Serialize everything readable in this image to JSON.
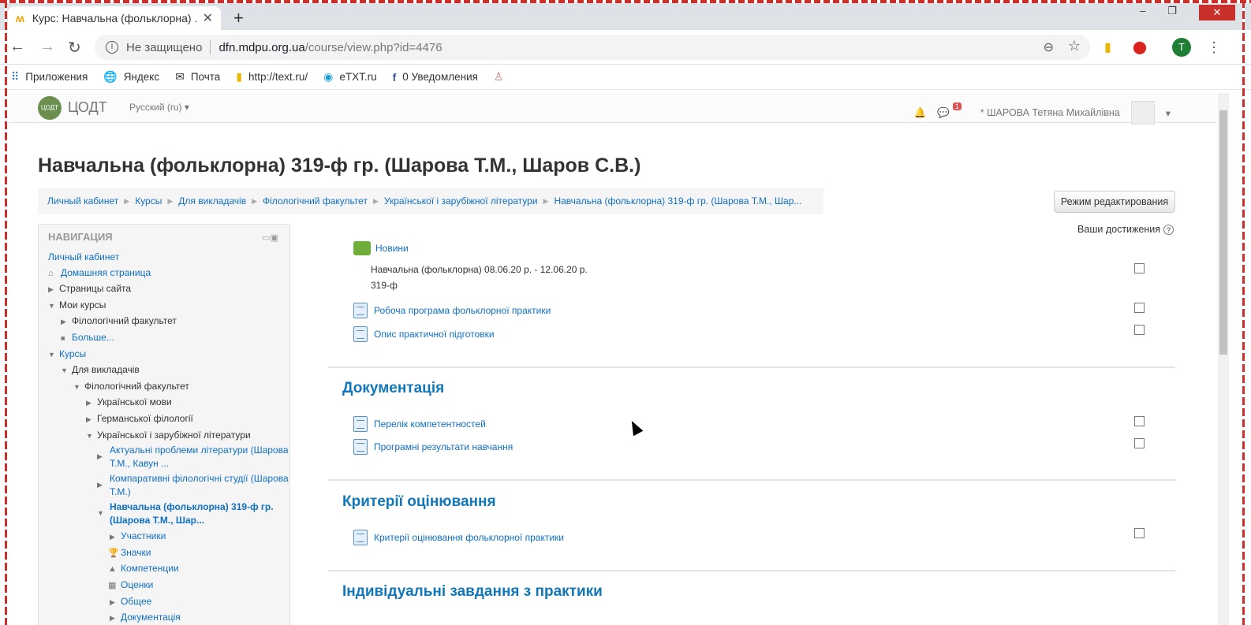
{
  "browser": {
    "tab_title": "Курс: Навчальна (фольклорна) ...",
    "tab_favicon": "moodle-favicon",
    "new_tab": "+",
    "not_secure": "Не защищено",
    "url_host": "dfn.mdpu.org.ua",
    "url_path": "/course/view.php?id=4476",
    "profile_letter": "T",
    "bookmarks": [
      {
        "label": "Приложения",
        "icon": "apps-grid-icon"
      },
      {
        "label": "Яндекс",
        "icon": "globe-icon"
      },
      {
        "label": "Почта",
        "icon": "mail-icon"
      },
      {
        "label": "http://text.ru/",
        "icon": "bookmark-flag-icon"
      },
      {
        "label": "eTXT.ru",
        "icon": "etxt-icon"
      },
      {
        "label": "0 Уведомления",
        "icon": "facebook-icon"
      }
    ]
  },
  "moodle": {
    "brand": "ЦОДТ",
    "logo_text": "ЦОДТ",
    "language": "Русский (ru) ▾",
    "notification_count": "1",
    "user_name": "* ШАРОВА Тетяна Михайлівна",
    "page_title": "Навчальна (фольклорна) 319-ф гр. (Шарова Т.М., Шаров С.В.)",
    "breadcrumbs": [
      "Личный кабинет",
      "Курсы",
      "Для викладачів",
      "Філологічний факультет",
      "Української і зарубіжної літератури",
      "Навчальна (фольклорна) 319-ф гр. (Шарова Т.М., Шар..."
    ],
    "edit_button": "Режим редактирования",
    "achievements": "Ваши достижения"
  },
  "navigation": {
    "title": "НАВИГАЦИЯ",
    "items": {
      "dashboard": "Личный кабинет",
      "home": "Домашняя страница",
      "site_pages": "Страницы сайта",
      "my_courses": "Мои курсы",
      "my_faculty": "Філологічний факультет",
      "more": "Больше...",
      "courses": "Курсы",
      "for_teachers": "Для викладачів",
      "faculty": "Філологічний факультет",
      "ukr_lang": "Української мови",
      "germ": "Германської філології",
      "ukr_lit": "Української і зарубіжної літератури",
      "course1": "Актуальні проблеми літератури (Шарова Т.М., Кавун ...",
      "course2": "Компаративні філологічні студії (Шарова Т.М.)",
      "course3": "Навчальна (фольклорна) 319-ф гр. (Шарова Т.М., Шар...",
      "participants": "Участники",
      "badges": "Значки",
      "competencies": "Компетенции",
      "grades": "Оценки",
      "general": "Общее",
      "documentation": "Документація"
    }
  },
  "content": {
    "news": "Новини",
    "summary": "Навчальна (фольклорна) 08.06.20 р. - 12.06.20 р. 319-ф",
    "activities_top": [
      "Робоча програма фольклорної практики",
      "Опис практичної підготовки"
    ],
    "sections": [
      {
        "title": "Документація",
        "activities": [
          "Перелік компетентностей",
          "Програмні результати навчання"
        ]
      },
      {
        "title": "Критерії оцінювання",
        "activities": [
          "Критерії оцінювання фольклорної практики"
        ]
      },
      {
        "title": "Індивідуальні завдання з практики",
        "activities": []
      }
    ]
  }
}
